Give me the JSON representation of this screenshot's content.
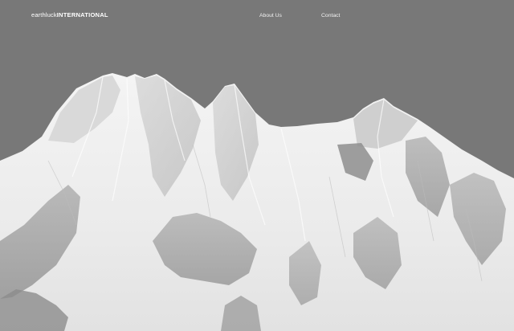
{
  "header": {
    "logo_part1": "earthluck",
    "logo_part2": "INTERNATIONAL",
    "nav": [
      {
        "label": "About Us"
      },
      {
        "label": "Contact"
      }
    ]
  },
  "hero": {
    "image_subject": "snow-covered mountain range",
    "sky_color": "#787878",
    "snow_color": "#f2f2f2",
    "rock_color": "#9a9a9a"
  }
}
